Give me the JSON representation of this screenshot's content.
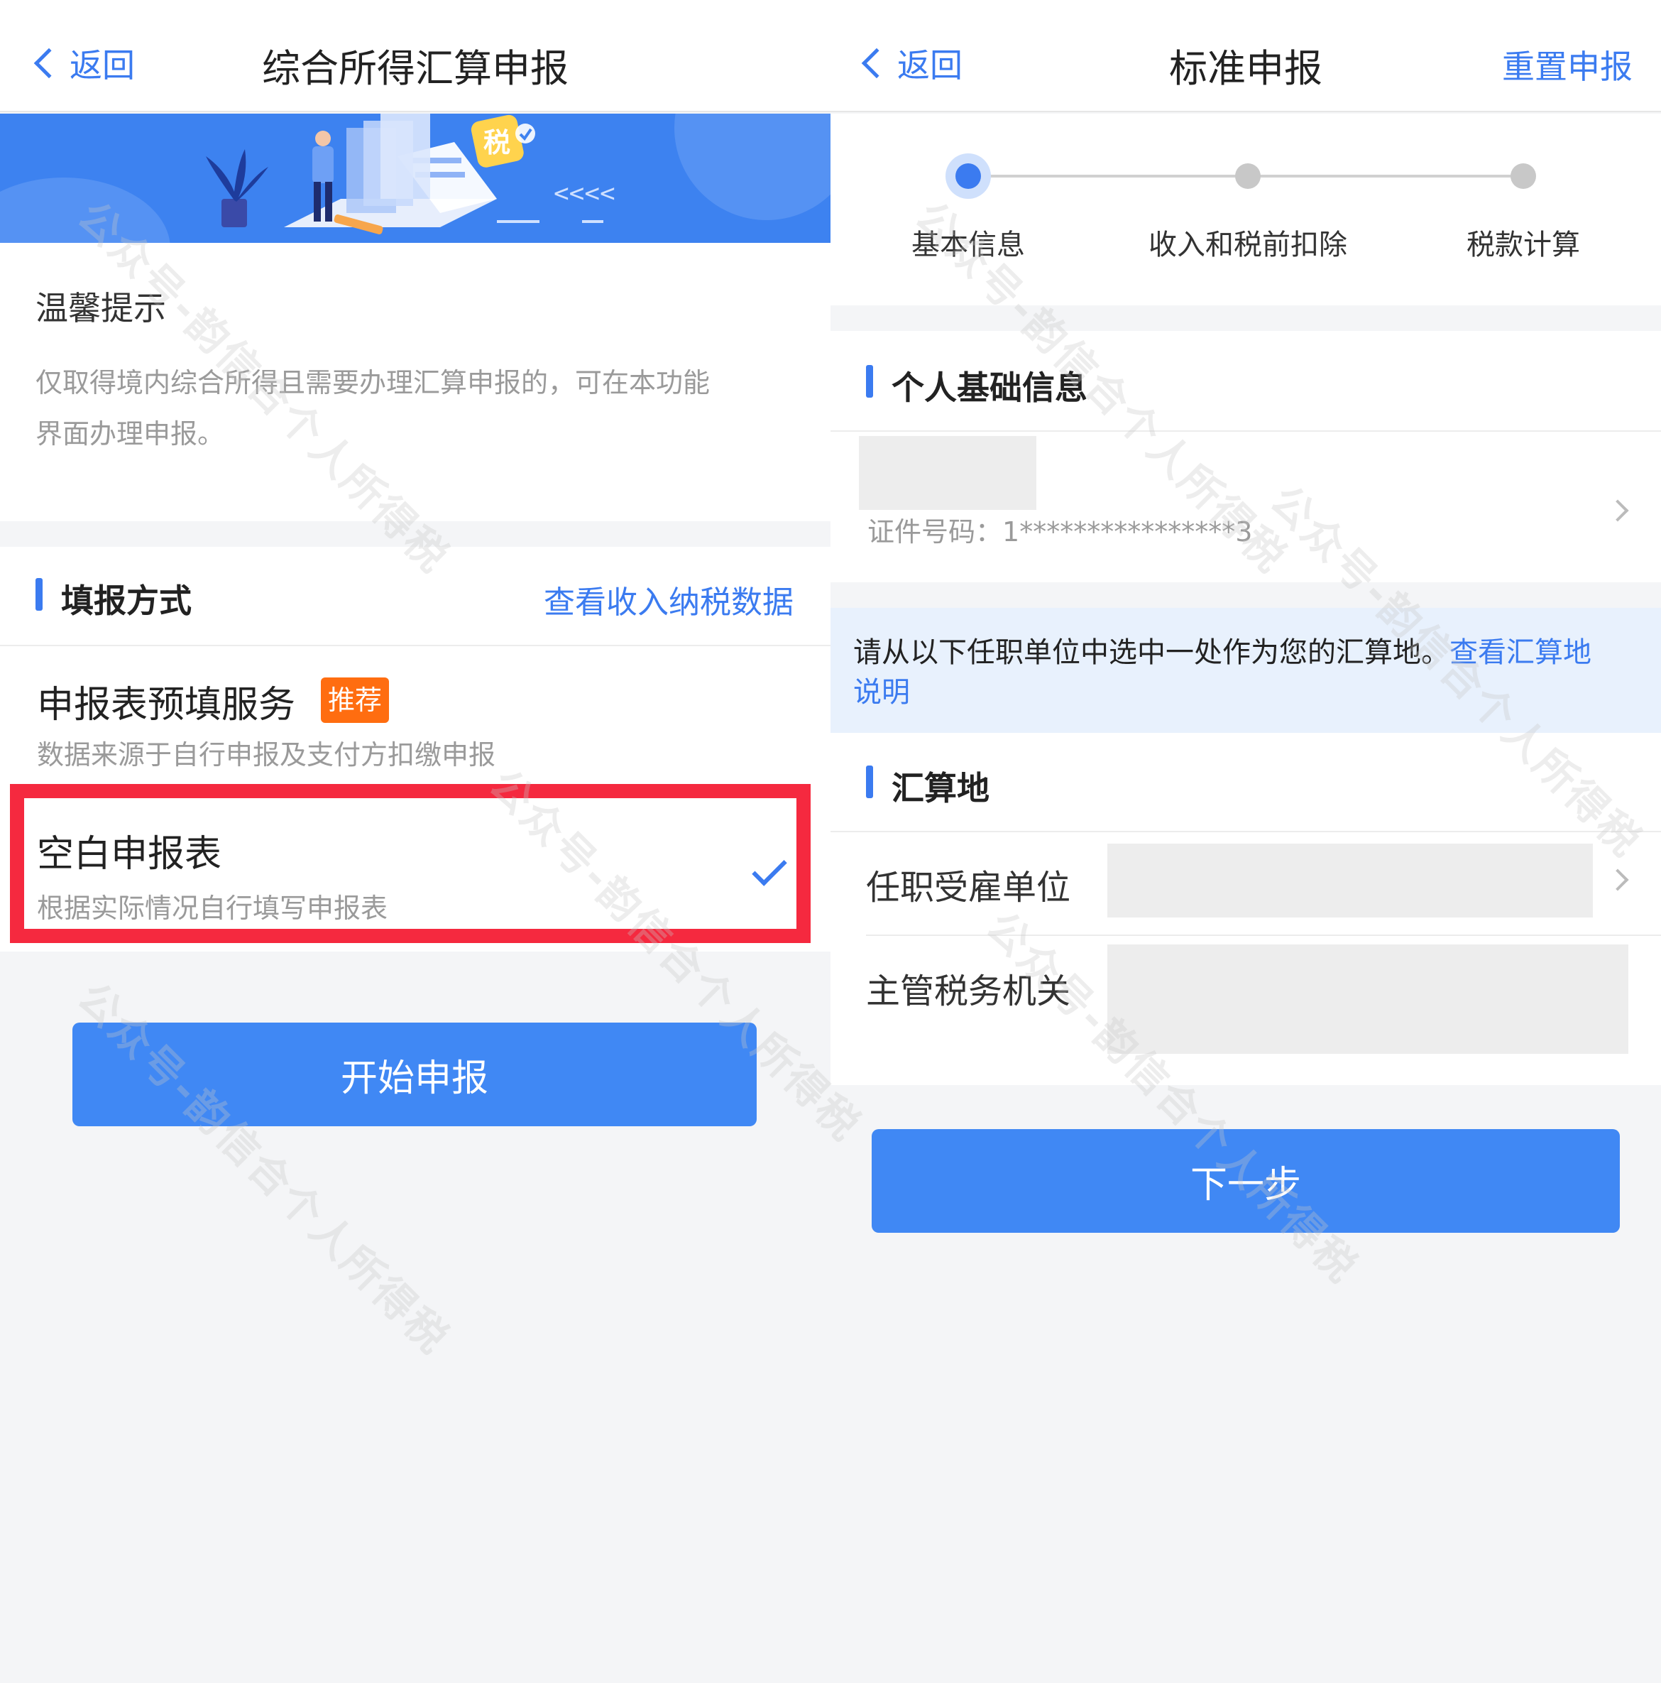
{
  "left": {
    "nav": {
      "back_label": "返回",
      "title": "综合所得汇算申报"
    },
    "banner": {
      "badge": "税",
      "arrows": "<<<<"
    },
    "tip": {
      "title": "温馨提示",
      "line1": "仅取得境内综合所得且需要办理汇算申报的，可在本功能",
      "line2": "界面办理申报。"
    },
    "method": {
      "title": "填报方式",
      "link": "查看收入纳税数据",
      "options": [
        {
          "title": "申报表预填服务",
          "tag": "推荐",
          "desc": "数据来源于自行申报及支付方扣缴申报",
          "selected": false
        },
        {
          "title": "空白申报表",
          "desc": "根据实际情况自行填写申报表",
          "selected": true
        }
      ]
    },
    "start_button": "开始申报"
  },
  "right": {
    "nav": {
      "back_label": "返回",
      "title": "标准申报",
      "action": "重置申报"
    },
    "steps": [
      {
        "label": "基本信息",
        "active": true
      },
      {
        "label": "收入和税前扣除",
        "active": false
      },
      {
        "label": "税款计算",
        "active": false
      }
    ],
    "personal": {
      "title": "个人基础信息",
      "id_label": "证件号码：",
      "id_value": "1****************3"
    },
    "notice": {
      "text": "请从以下任职单位中选中一处作为您的汇算地。",
      "link_part1": "查看汇算地",
      "link_part2": "说明"
    },
    "location": {
      "title": "汇算地",
      "employer_label": "任职受雇单位",
      "tax_office_label": "主管税务机关"
    },
    "next_button": "下一步"
  },
  "watermark_text": "公众号-韵信合个人所得税",
  "colors": {
    "accent": "#3b7bf0",
    "button": "#4088f4",
    "highlight": "#f5293f",
    "tag": "#ff6d10"
  }
}
